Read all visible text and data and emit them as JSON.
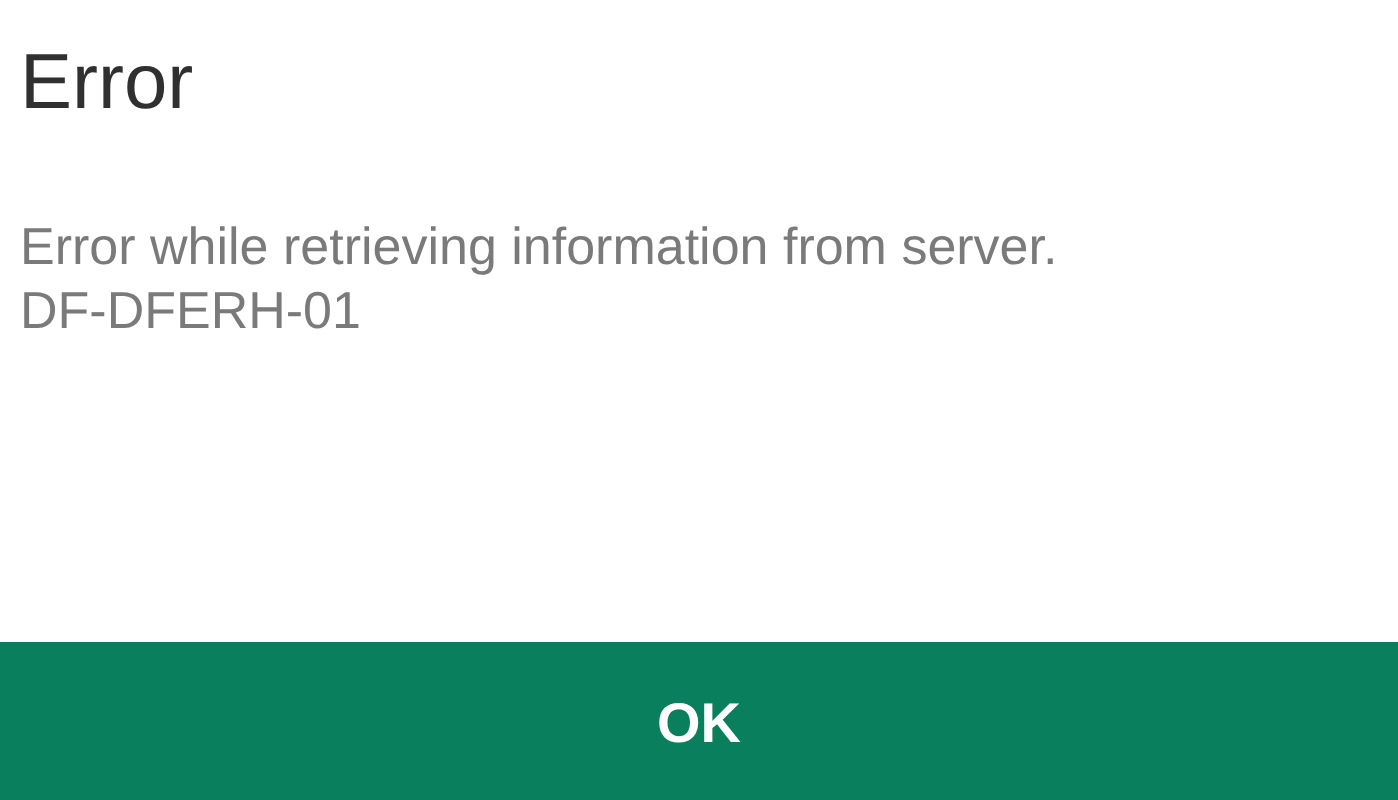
{
  "dialog": {
    "title": "Error",
    "message": "Error while retrieving information from server.",
    "code": "DF-DFERH-01"
  },
  "buttons": [
    {
      "label": "OK"
    }
  ]
}
